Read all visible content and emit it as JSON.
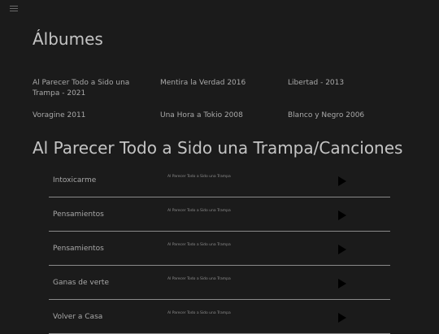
{
  "page": {
    "albums_title": "Álbumes",
    "songs_title": "Al Parecer Todo a Sido una Trampa/Canciones"
  },
  "albums": [
    {
      "label": "Al Parecer Todo a Sido una Trampa - 2021"
    },
    {
      "label": "Mentira la Verdad 2016"
    },
    {
      "label": "Libertad - 2013"
    },
    {
      "label": "Voragine 2011"
    },
    {
      "label": "Una Hora a Tokio 2008"
    },
    {
      "label": "Blanco y Negro 2006"
    }
  ],
  "songs": [
    {
      "name": "Intoxicarme",
      "album": "Al Parecer Todo a Sido una Trampa"
    },
    {
      "name": "Pensamientos",
      "album": "Al Parecer Todo a Sido una Trampa"
    },
    {
      "name": "Pensamientos",
      "album": "Al Parecer Todo a Sido una Trampa"
    },
    {
      "name": "Ganas de verte",
      "album": "Al Parecer Todo a Sido una Trampa"
    },
    {
      "name": "Volver a Casa",
      "album": "Al Parecer Todo a Sido una Trampa"
    }
  ],
  "icons": {
    "menu": "hamburger-menu-icon",
    "play": "play-icon"
  },
  "colors": {
    "background": "#1b1b1b",
    "text": "#bdbdbd",
    "divider": "#8a8a8a",
    "play": "#000000"
  }
}
